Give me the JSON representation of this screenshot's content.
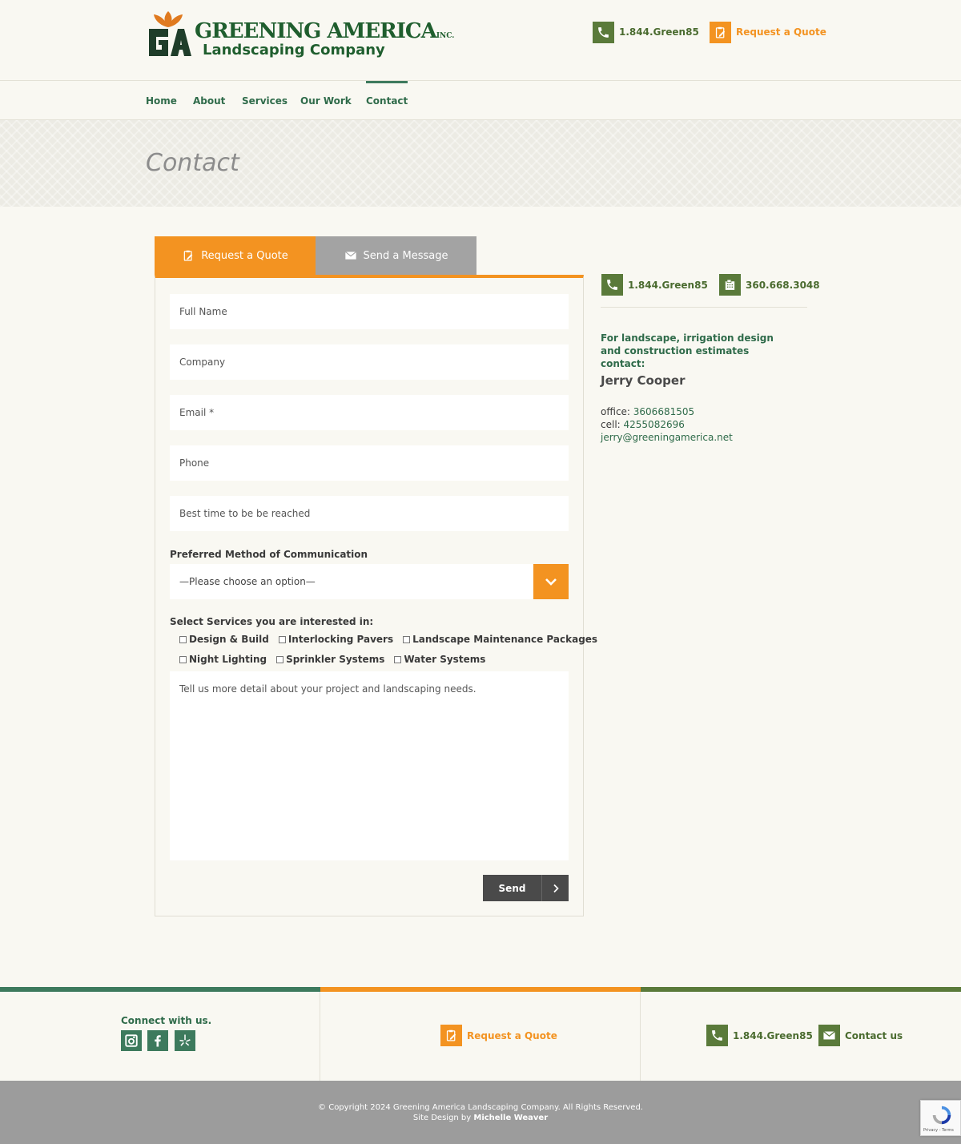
{
  "header": {
    "logo_line1": "GREENING AMERICA",
    "logo_inc": "INC.",
    "logo_line2": "Landscaping Company",
    "phone": "1.844.Green85",
    "quote": "Request a Quote"
  },
  "nav": {
    "items": [
      {
        "label": "Home"
      },
      {
        "label": "About"
      },
      {
        "label": "Services"
      },
      {
        "label": "Our Work"
      },
      {
        "label": "Contact"
      }
    ]
  },
  "page_title": "Contact",
  "tabs": {
    "quote": "Request a Quote",
    "message": "Send a Message"
  },
  "form": {
    "full_name": "Full Name",
    "company": "Company",
    "email": "Email *",
    "phone": "Phone",
    "best_time": "Best time to be be reached",
    "preferred_label": "Preferred Method of Communication",
    "preferred_value": "—Please choose an option—",
    "services_label": "Select Services you are interested in:",
    "services_row1": [
      "Design & Build",
      "Interlocking Pavers",
      "Landscape Maintenance Packages"
    ],
    "services_row2": [
      "Night Lighting",
      "Sprinkler Systems",
      "Water Systems"
    ],
    "details": "Tell us more detail about your project and landscaping needs.",
    "send": "Send"
  },
  "sidebar": {
    "phone": "1.844.Green85",
    "fax": "360.668.3048",
    "intro": "For landscape, irrigation design and construction estimates contact:",
    "name": "Jerry Cooper",
    "office_label": "office: ",
    "office_number": "3606681505",
    "cell_label": "cell: ",
    "cell_number": "4255082696",
    "email": "jerry@greeningamerica.net"
  },
  "footer": {
    "connect": "Connect with us.",
    "quote": "Request a Quote",
    "phone": "1.844.Green85",
    "contact": "Contact us",
    "copyright": "© Copyright 2024 Greening America Landscaping Company. All Rights Reserved.",
    "design_prefix": "Site Design by ",
    "designer": "Michelle Weaver",
    "recaptcha": "Privacy - Terms"
  },
  "colors": {
    "green": "#2f6b4a",
    "olive": "#5a7a3a",
    "orange": "#f39321",
    "gray": "#9c9c9c"
  }
}
